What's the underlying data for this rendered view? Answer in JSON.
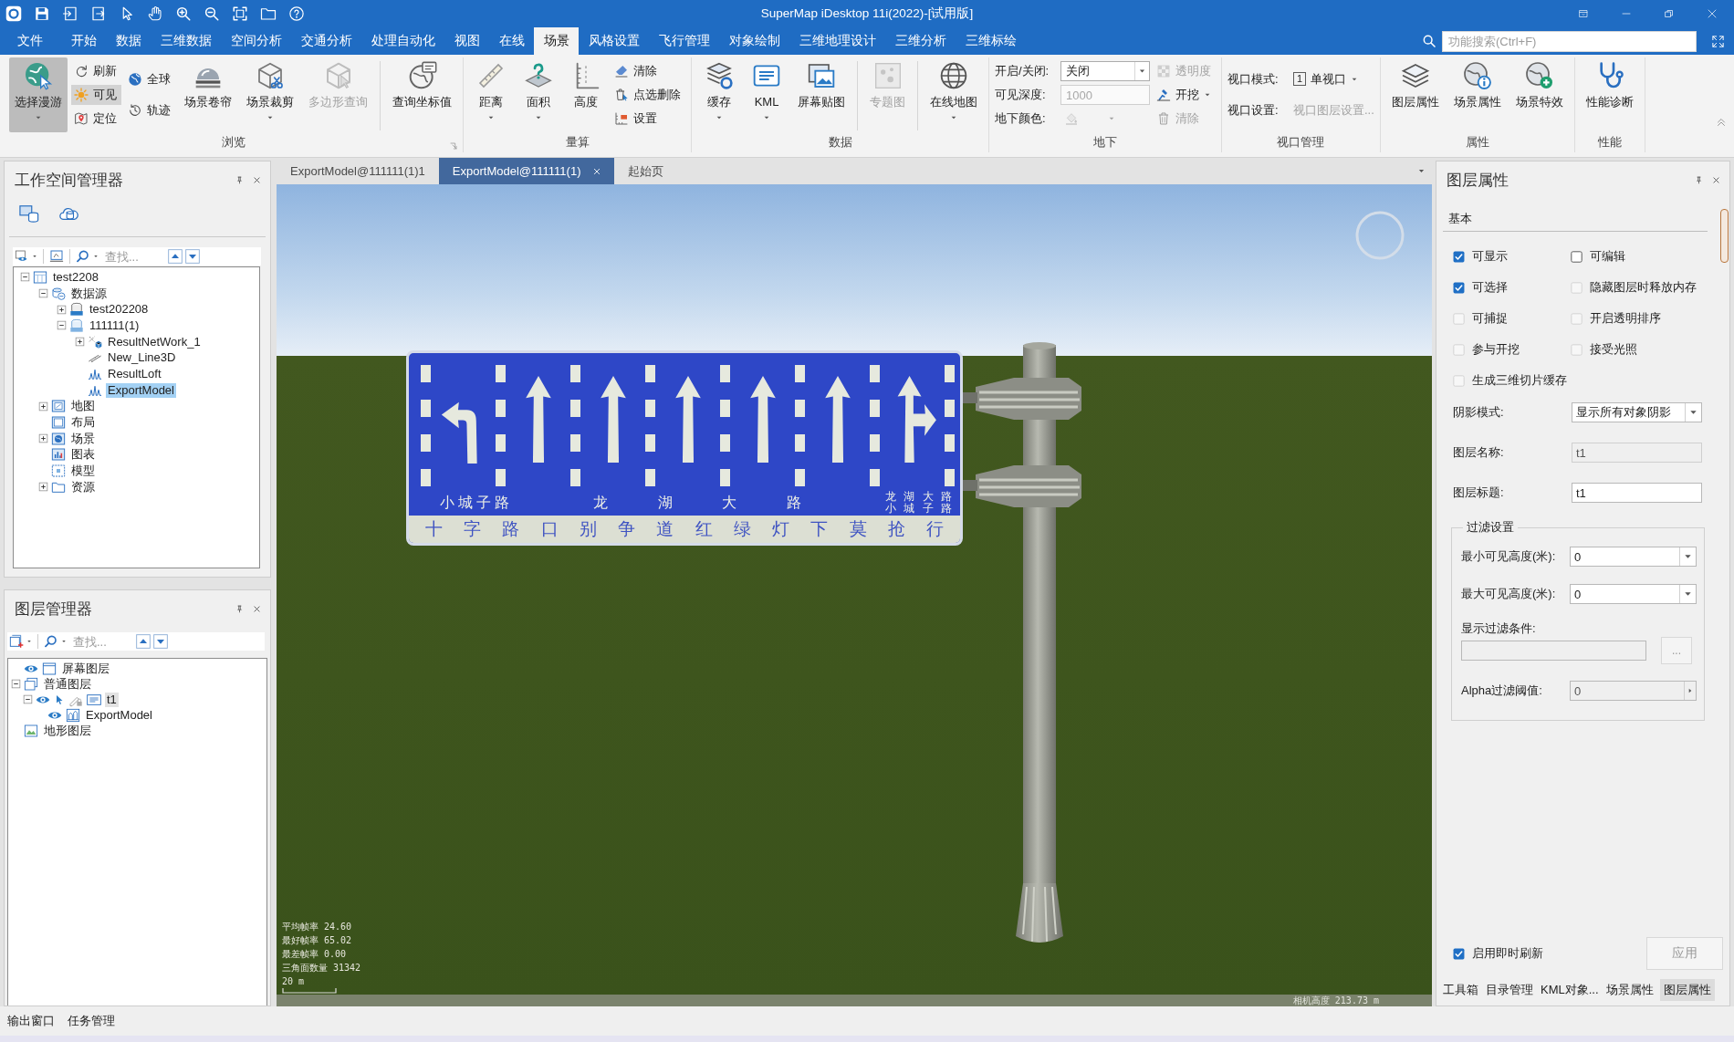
{
  "title_bar": {
    "title": "SuperMap iDesktop 11i(2022)-[试用版]"
  },
  "menu_tabs": [
    {
      "label": "文件",
      "selected": false
    },
    {
      "label": "开始",
      "selected": false
    },
    {
      "label": "数据",
      "selected": false
    },
    {
      "label": "三维数据",
      "selected": false
    },
    {
      "label": "空间分析",
      "selected": false
    },
    {
      "label": "交通分析",
      "selected": false
    },
    {
      "label": "处理自动化",
      "selected": false
    },
    {
      "label": "视图",
      "selected": false
    },
    {
      "label": "在线",
      "selected": false
    },
    {
      "label": "场景",
      "selected": true
    },
    {
      "label": "风格设置",
      "selected": false
    },
    {
      "label": "飞行管理",
      "selected": false
    },
    {
      "label": "对象绘制",
      "selected": false
    },
    {
      "label": "三维地理设计",
      "selected": false
    },
    {
      "label": "三维分析",
      "selected": false
    },
    {
      "label": "三维标绘",
      "selected": false
    }
  ],
  "search": {
    "placeholder": "功能搜索(Ctrl+F)"
  },
  "ribbon": {
    "groups": [
      {
        "label": "浏览",
        "launcher": true,
        "items": [
          {
            "kind": "large",
            "label": "选择漫游",
            "dropdown": true,
            "pressed": true,
            "disabled": false
          },
          {
            "kind": "stack",
            "buttons": [
              {
                "label": "刷新",
                "dropdown": false,
                "pressed": false,
                "disabled": false
              },
              {
                "label": "可见",
                "dropdown": false,
                "pressed": true,
                "disabled": false
              },
              {
                "label": "定位",
                "dropdown": false,
                "pressed": false,
                "disabled": false
              }
            ]
          },
          {
            "kind": "stack",
            "buttons": [
              {
                "label": "全球",
                "dropdown": false,
                "pressed": false,
                "disabled": false
              },
              {
                "label": "轨迹",
                "dropdown": false,
                "pressed": false,
                "disabled": false
              }
            ]
          },
          {
            "kind": "large",
            "label": "场景卷帘",
            "dropdown": false,
            "pressed": false,
            "disabled": false
          },
          {
            "kind": "large",
            "label": "场景裁剪",
            "dropdown": true,
            "pressed": false,
            "disabled": false
          },
          {
            "kind": "large",
            "label": "多边形查询",
            "dropdown": false,
            "pressed": false,
            "disabled": true
          },
          {
            "kind": "separator"
          },
          {
            "kind": "large",
            "label": "查询坐标值",
            "dropdown": false,
            "pressed": false,
            "disabled": false
          }
        ]
      },
      {
        "label": "量算",
        "items": [
          {
            "kind": "large",
            "label": "距离",
            "dropdown": true,
            "pressed": false,
            "disabled": false
          },
          {
            "kind": "large",
            "label": "面积",
            "dropdown": true,
            "pressed": false,
            "disabled": false
          },
          {
            "kind": "large",
            "label": "高度",
            "dropdown": false,
            "pressed": false,
            "disabled": false
          },
          {
            "kind": "stack",
            "buttons": [
              {
                "label": "清除",
                "dropdown": false,
                "pressed": false,
                "disabled": false
              },
              {
                "label": "点选删除",
                "dropdown": false,
                "pressed": false,
                "disabled": false
              },
              {
                "label": "设置",
                "dropdown": false,
                "pressed": false,
                "disabled": false
              }
            ]
          }
        ]
      },
      {
        "label": "数据",
        "items": [
          {
            "kind": "large",
            "label": "缓存",
            "dropdown": true,
            "pressed": false,
            "disabled": false
          },
          {
            "kind": "large",
            "label": "KML",
            "dropdown": true,
            "pressed": false,
            "disabled": false
          },
          {
            "kind": "large",
            "label": "屏幕贴图",
            "dropdown": false,
            "pressed": false,
            "disabled": false
          },
          {
            "kind": "separator"
          },
          {
            "kind": "large",
            "label": "专题图",
            "dropdown": false,
            "pressed": false,
            "disabled": true
          },
          {
            "kind": "separator"
          },
          {
            "kind": "large",
            "label": "在线地图",
            "dropdown": true,
            "pressed": false,
            "disabled": false
          }
        ]
      },
      {
        "label": "地下",
        "items": [
          {
            "kind": "form",
            "rows": [
              {
                "label": "开启/关闭:",
                "kind": "combo",
                "value": "关闭",
                "disabled": false
              },
              {
                "label": "可见深度:",
                "kind": "text",
                "value": "1000",
                "disabled": true
              },
              {
                "label": "地下颜色:",
                "kind": "color",
                "disabled": true
              }
            ]
          },
          {
            "kind": "stack",
            "buttons": [
              {
                "label": "透明度",
                "dropdown": false,
                "pressed": false,
                "disabled": true
              },
              {
                "label": "开挖",
                "dropdown": true,
                "pressed": false,
                "disabled": false
              },
              {
                "label": "清除",
                "dropdown": false,
                "pressed": false,
                "disabled": true
              }
            ]
          }
        ]
      },
      {
        "label": "视口管理",
        "items": [
          {
            "kind": "form",
            "rows": [
              {
                "label": "视口模式:",
                "kind": "menu",
                "badge": "1",
                "value": "单视口",
                "disabled": false
              },
              {
                "label": "视口设置:",
                "kind": "link",
                "value": "视口图层设置...",
                "disabled": true
              }
            ]
          }
        ]
      },
      {
        "label": "属性",
        "items": [
          {
            "kind": "large",
            "label": "图层属性",
            "dropdown": false,
            "pressed": false,
            "disabled": false
          },
          {
            "kind": "large",
            "label": "场景属性",
            "dropdown": false,
            "pressed": false,
            "disabled": false
          },
          {
            "kind": "large",
            "label": "场景特效",
            "dropdown": false,
            "pressed": false,
            "disabled": false
          }
        ]
      },
      {
        "label": "性能",
        "items": [
          {
            "kind": "large",
            "label": "性能诊断",
            "dropdown": false,
            "pressed": false,
            "disabled": false
          }
        ]
      }
    ]
  },
  "document_tabs": [
    {
      "label": "ExportModel@111111(1)1",
      "selected": false
    },
    {
      "label": "ExportModel@111111(1)",
      "selected": true
    },
    {
      "label": "起始页",
      "selected": false
    }
  ],
  "workspace_manager": {
    "title": "工作空间管理器",
    "search_placeholder": "查找...",
    "tree": [
      {
        "label": "test2208",
        "kind": "workspace",
        "expanded": true,
        "selected": false,
        "children": [
          {
            "label": "数据源",
            "kind": "datasources",
            "expanded": true,
            "selected": false,
            "children": [
              {
                "label": "test202208",
                "kind": "datasource-udx",
                "expanded": false,
                "selected": false
              },
              {
                "label": "111111(1)",
                "kind": "datasource-udb",
                "expanded": true,
                "selected": false,
                "children": [
                  {
                    "label": "ResultNetWork_1",
                    "kind": "network",
                    "expanded": false,
                    "selected": false
                  },
                  {
                    "label": "New_Line3D",
                    "kind": "line3d",
                    "selected": false
                  },
                  {
                    "label": "ResultLoft",
                    "kind": "model",
                    "selected": false
                  },
                  {
                    "label": "ExportModel",
                    "kind": "model",
                    "selected": true
                  }
                ]
              }
            ]
          },
          {
            "label": "地图",
            "kind": "maps",
            "expanded": false,
            "selected": false
          },
          {
            "label": "布局",
            "kind": "layouts",
            "selected": false
          },
          {
            "label": "场景",
            "kind": "scenes",
            "expanded": false,
            "selected": false
          },
          {
            "label": "图表",
            "kind": "charts",
            "selected": false
          },
          {
            "label": "模型",
            "kind": "models",
            "selected": false
          },
          {
            "label": "资源",
            "kind": "resources",
            "expanded": false,
            "selected": false
          }
        ]
      }
    ]
  },
  "layer_manager": {
    "title": "图层管理器",
    "search_placeholder": "查找...",
    "tree": [
      {
        "label": "屏幕图层",
        "kind": "screen",
        "visible": true,
        "selected": false
      },
      {
        "label": "普通图层",
        "kind": "group",
        "expanded": true,
        "selected": false,
        "children": [
          {
            "label": "t1",
            "kind": "kml",
            "expanded": true,
            "visible": true,
            "selectable": true,
            "editable": false,
            "selected": true,
            "children": [
              {
                "label": "ExportModel",
                "kind": "model",
                "visible": true,
                "selected": false
              }
            ]
          }
        ]
      },
      {
        "label": "地形图层",
        "kind": "terrain",
        "selected": false
      }
    ]
  },
  "scene": {
    "sign": {
      "lanes": [
        {
          "kind": "left-turn"
        },
        {
          "kind": "straight"
        },
        {
          "kind": "straight"
        },
        {
          "kind": "straight"
        },
        {
          "kind": "straight"
        },
        {
          "kind": "straight"
        },
        {
          "kind": "straight-right"
        }
      ],
      "road_names": [
        {
          "lines": [
            "小城子路"
          ]
        },
        {
          "lines": [
            "龙 湖 大 路"
          ]
        },
        {
          "lines": [
            "龙 湖 大 路",
            "小 城 子 路"
          ]
        }
      ],
      "slogan": "十 字 路 口 别 争 道 红 绿 灯 下 莫 抢 行"
    },
    "stats": [
      "平均帧率 24.60",
      "最好帧率 65.02",
      "最差帧率 0.00",
      "三角面数量 31342"
    ],
    "scale": "20 m",
    "camera_height": "相机高度 213.73 m"
  },
  "layer_properties": {
    "title": "图层属性",
    "section": "基本",
    "checkboxes": [
      {
        "label": "可显示",
        "checked": true,
        "disabled": false
      },
      {
        "label": "可编辑",
        "checked": false,
        "disabled": false
      },
      {
        "label": "可选择",
        "checked": true,
        "disabled": false
      },
      {
        "label": "隐藏图层时释放内存",
        "checked": false,
        "disabled": true
      },
      {
        "label": "可捕捉",
        "checked": false,
        "disabled": true
      },
      {
        "label": "开启透明排序",
        "checked": false,
        "disabled": true
      },
      {
        "label": "参与开挖",
        "checked": false,
        "disabled": true
      },
      {
        "label": "接受光照",
        "checked": false,
        "disabled": true
      },
      {
        "label": "生成三维切片缓存",
        "checked": false,
        "disabled": true
      }
    ],
    "fields": [
      {
        "label": "阴影模式:",
        "kind": "combo",
        "value": "显示所有对象阴影",
        "disabled": false
      },
      {
        "label": "图层名称:",
        "kind": "text",
        "value": "t1",
        "disabled": true
      },
      {
        "label": "图层标题:",
        "kind": "text",
        "value": "t1",
        "disabled": false
      }
    ],
    "filter": {
      "title": "过滤设置",
      "fields": [
        {
          "label": "最小可见高度(米):",
          "kind": "combo",
          "value": "0",
          "disabled": false
        },
        {
          "label": "最大可见高度(米):",
          "kind": "combo",
          "value": "0",
          "disabled": false
        },
        {
          "label": "显示过滤条件:",
          "kind": "expression",
          "button": "...",
          "disabled": true
        },
        {
          "label": "Alpha过滤阈值:",
          "kind": "spin",
          "value": "0",
          "disabled": true
        }
      ]
    },
    "auto_refresh": {
      "label": "启用即时刷新",
      "checked": true
    },
    "apply_button": {
      "label": "应用",
      "disabled": true
    }
  },
  "panel_tabs": [
    {
      "label": "工具箱",
      "selected": false
    },
    {
      "label": "目录管理",
      "selected": false
    },
    {
      "label": "KML对象...",
      "selected": false
    },
    {
      "label": "场景属性",
      "selected": false
    },
    {
      "label": "图层属性",
      "selected": true
    }
  ],
  "status_tabs": [
    "输出窗口",
    "任务管理"
  ]
}
